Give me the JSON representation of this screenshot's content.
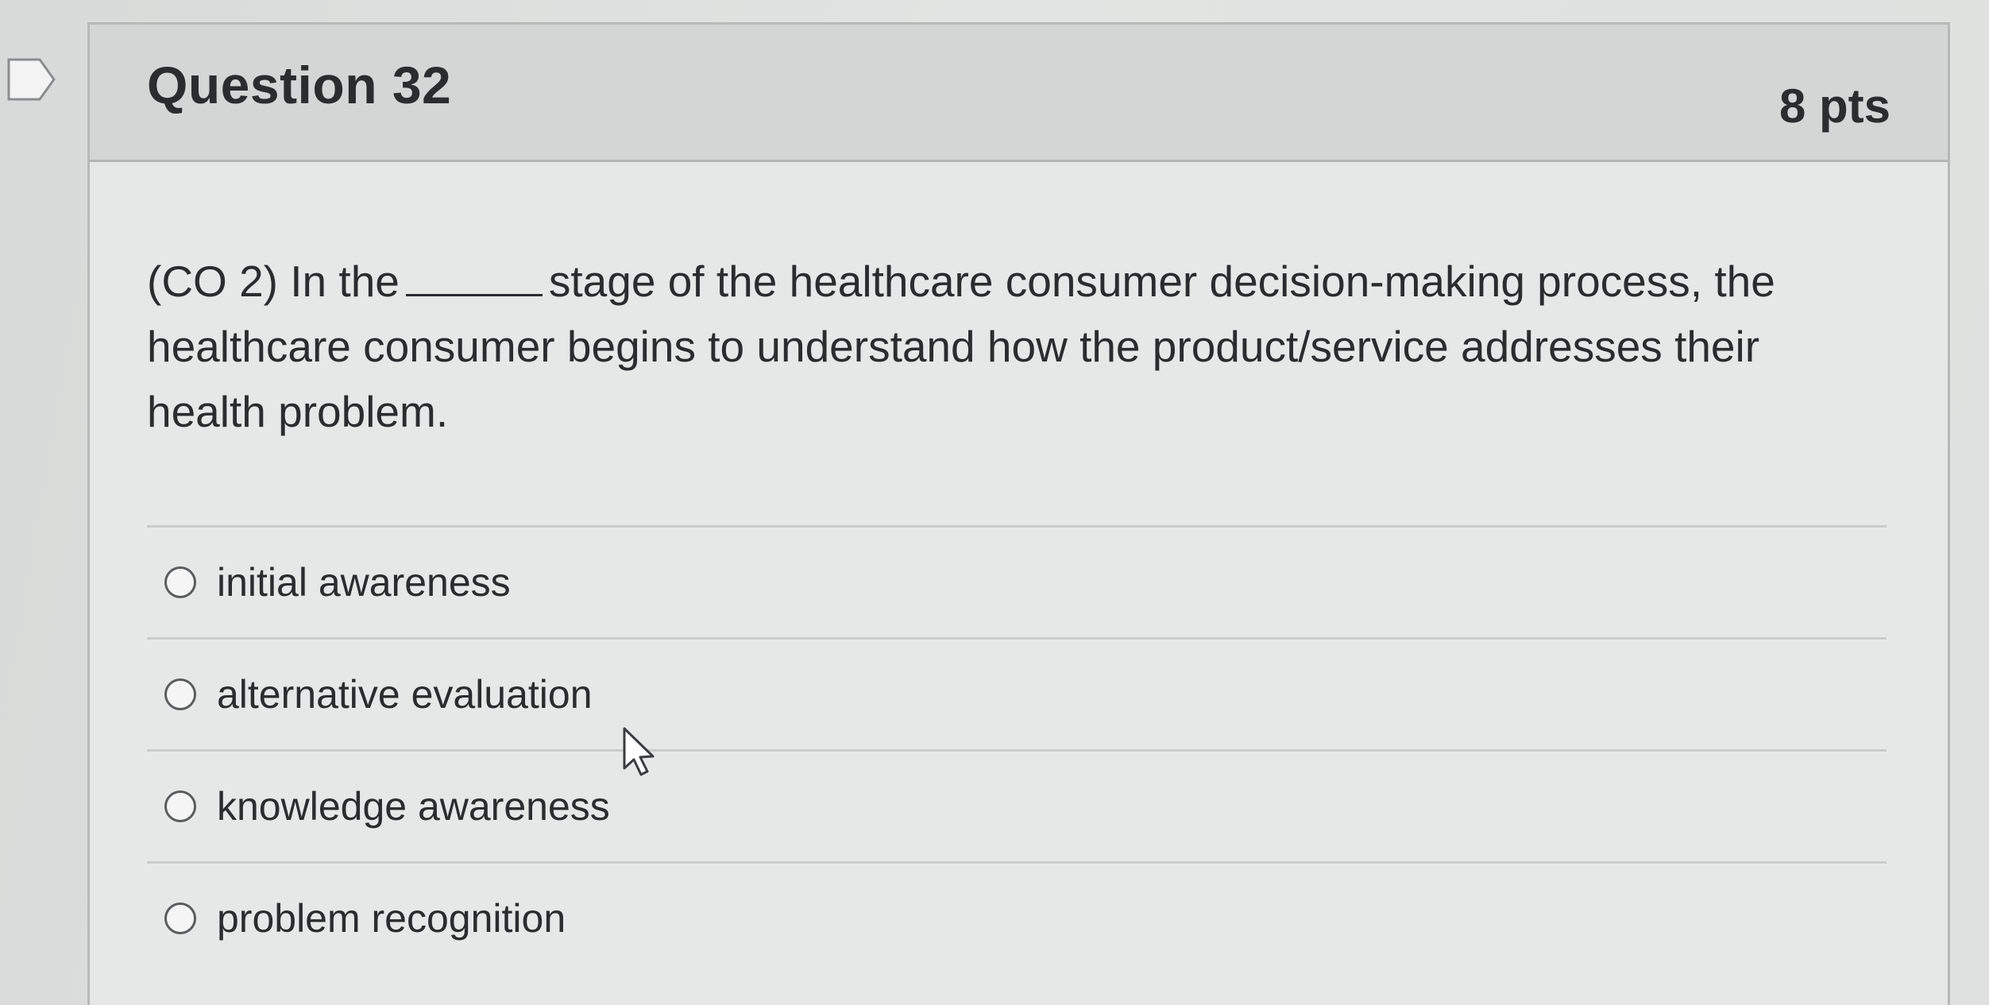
{
  "question": {
    "title": "Question 32",
    "points": "8 pts",
    "text_before_blank": "(CO 2) In the",
    "text_after_blank": "stage of the healthcare consumer decision-making process, the healthcare consumer begins to understand how the product/service addresses their health problem."
  },
  "answers": [
    {
      "label": "initial awareness",
      "selected": false
    },
    {
      "label": "alternative evaluation",
      "selected": false
    },
    {
      "label": "knowledge awareness",
      "selected": false
    },
    {
      "label": "problem recognition",
      "selected": false
    }
  ],
  "icons": {
    "flag": "flag-icon",
    "radio": "radio-button",
    "cursor": "mouse-pointer-icon"
  },
  "colors": {
    "background": "#d9dbda",
    "card": "#e6e8e7",
    "header": "#d4d6d5",
    "text": "#2a2c2e"
  }
}
